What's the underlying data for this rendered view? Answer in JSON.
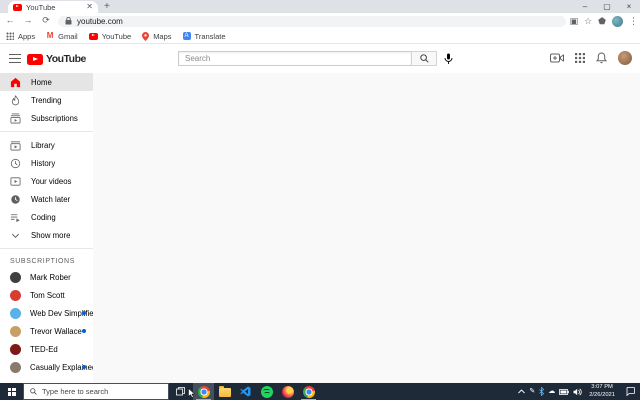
{
  "browser": {
    "tab_title": "YouTube",
    "url": "youtube.com",
    "window_controls": {
      "minimize": "–",
      "maximize": "▢",
      "close": "×"
    },
    "bookmarks": {
      "apps": "Apps",
      "gmail": "Gmail",
      "youtube": "YouTube",
      "maps": "Maps",
      "translate": "Translate"
    }
  },
  "youtube": {
    "logo_text": "YouTube",
    "search_placeholder": "Search",
    "sidebar": {
      "primary": [
        "Home",
        "Trending",
        "Subscriptions"
      ],
      "secondary": [
        "Library",
        "History",
        "Your videos",
        "Watch later",
        "Coding",
        "Show more"
      ],
      "subscriptions_header": "SUBSCRIPTIONS",
      "channels": [
        {
          "name": "Mark Rober",
          "color": "#3f3f3f",
          "has_new": false
        },
        {
          "name": "Tom Scott",
          "color": "#d63e32",
          "has_new": false
        },
        {
          "name": "Web Dev Simplified",
          "color": "#56b2e8",
          "has_new": true
        },
        {
          "name": "Trevor Wallace",
          "color": "#c9a063",
          "has_new": true
        },
        {
          "name": "TED-Ed",
          "color": "#7c1a15",
          "has_new": false
        },
        {
          "name": "Casually Explained",
          "color": "#8a7a6c",
          "has_new": true
        }
      ]
    }
  },
  "taskbar": {
    "search_placeholder": "Type here to search",
    "clock": {
      "time": "3:07 PM",
      "date": "2/26/2021"
    }
  },
  "colors": {
    "accent_red": "#ff0000",
    "new_dot": "#065fd4",
    "content_bg": "#f9f9f9",
    "taskbar_bg": "#1e2a38"
  }
}
